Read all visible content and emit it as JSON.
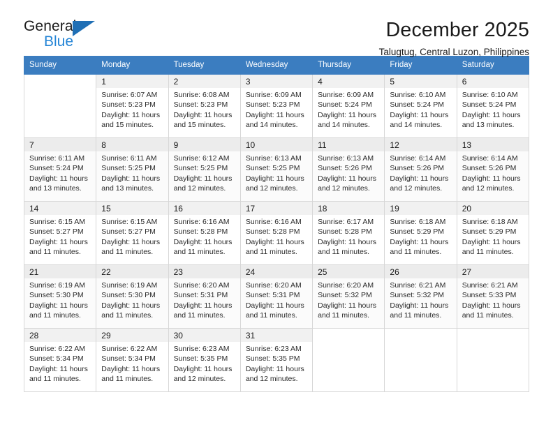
{
  "brand": {
    "name_top": "General",
    "name_bottom": "Blue",
    "triangle_color": "#1f6fb5",
    "blue_text_color": "#2585d6"
  },
  "header": {
    "title": "December 2025",
    "subtitle": "Talugtug, Central Luzon, Philippines"
  },
  "theme": {
    "header_bg": "#3b7dc0",
    "header_text": "#ffffff",
    "grid_border": "#d7d7d7",
    "daynum_bg": "#f1f1f1",
    "row_alt_bg": "#fbfbfb"
  },
  "weekdays": [
    "Sunday",
    "Monday",
    "Tuesday",
    "Wednesday",
    "Thursday",
    "Friday",
    "Saturday"
  ],
  "weeks": [
    [
      {
        "day": "",
        "sunrise": "",
        "sunset": "",
        "daylight_1": "",
        "daylight_2": ""
      },
      {
        "day": "1",
        "sunrise": "Sunrise: 6:07 AM",
        "sunset": "Sunset: 5:23 PM",
        "daylight_1": "Daylight: 11 hours",
        "daylight_2": "and 15 minutes."
      },
      {
        "day": "2",
        "sunrise": "Sunrise: 6:08 AM",
        "sunset": "Sunset: 5:23 PM",
        "daylight_1": "Daylight: 11 hours",
        "daylight_2": "and 15 minutes."
      },
      {
        "day": "3",
        "sunrise": "Sunrise: 6:09 AM",
        "sunset": "Sunset: 5:23 PM",
        "daylight_1": "Daylight: 11 hours",
        "daylight_2": "and 14 minutes."
      },
      {
        "day": "4",
        "sunrise": "Sunrise: 6:09 AM",
        "sunset": "Sunset: 5:24 PM",
        "daylight_1": "Daylight: 11 hours",
        "daylight_2": "and 14 minutes."
      },
      {
        "day": "5",
        "sunrise": "Sunrise: 6:10 AM",
        "sunset": "Sunset: 5:24 PM",
        "daylight_1": "Daylight: 11 hours",
        "daylight_2": "and 14 minutes."
      },
      {
        "day": "6",
        "sunrise": "Sunrise: 6:10 AM",
        "sunset": "Sunset: 5:24 PM",
        "daylight_1": "Daylight: 11 hours",
        "daylight_2": "and 13 minutes."
      }
    ],
    [
      {
        "day": "7",
        "sunrise": "Sunrise: 6:11 AM",
        "sunset": "Sunset: 5:24 PM",
        "daylight_1": "Daylight: 11 hours",
        "daylight_2": "and 13 minutes."
      },
      {
        "day": "8",
        "sunrise": "Sunrise: 6:11 AM",
        "sunset": "Sunset: 5:25 PM",
        "daylight_1": "Daylight: 11 hours",
        "daylight_2": "and 13 minutes."
      },
      {
        "day": "9",
        "sunrise": "Sunrise: 6:12 AM",
        "sunset": "Sunset: 5:25 PM",
        "daylight_1": "Daylight: 11 hours",
        "daylight_2": "and 12 minutes."
      },
      {
        "day": "10",
        "sunrise": "Sunrise: 6:13 AM",
        "sunset": "Sunset: 5:25 PM",
        "daylight_1": "Daylight: 11 hours",
        "daylight_2": "and 12 minutes."
      },
      {
        "day": "11",
        "sunrise": "Sunrise: 6:13 AM",
        "sunset": "Sunset: 5:26 PM",
        "daylight_1": "Daylight: 11 hours",
        "daylight_2": "and 12 minutes."
      },
      {
        "day": "12",
        "sunrise": "Sunrise: 6:14 AM",
        "sunset": "Sunset: 5:26 PM",
        "daylight_1": "Daylight: 11 hours",
        "daylight_2": "and 12 minutes."
      },
      {
        "day": "13",
        "sunrise": "Sunrise: 6:14 AM",
        "sunset": "Sunset: 5:26 PM",
        "daylight_1": "Daylight: 11 hours",
        "daylight_2": "and 12 minutes."
      }
    ],
    [
      {
        "day": "14",
        "sunrise": "Sunrise: 6:15 AM",
        "sunset": "Sunset: 5:27 PM",
        "daylight_1": "Daylight: 11 hours",
        "daylight_2": "and 11 minutes."
      },
      {
        "day": "15",
        "sunrise": "Sunrise: 6:15 AM",
        "sunset": "Sunset: 5:27 PM",
        "daylight_1": "Daylight: 11 hours",
        "daylight_2": "and 11 minutes."
      },
      {
        "day": "16",
        "sunrise": "Sunrise: 6:16 AM",
        "sunset": "Sunset: 5:28 PM",
        "daylight_1": "Daylight: 11 hours",
        "daylight_2": "and 11 minutes."
      },
      {
        "day": "17",
        "sunrise": "Sunrise: 6:16 AM",
        "sunset": "Sunset: 5:28 PM",
        "daylight_1": "Daylight: 11 hours",
        "daylight_2": "and 11 minutes."
      },
      {
        "day": "18",
        "sunrise": "Sunrise: 6:17 AM",
        "sunset": "Sunset: 5:28 PM",
        "daylight_1": "Daylight: 11 hours",
        "daylight_2": "and 11 minutes."
      },
      {
        "day": "19",
        "sunrise": "Sunrise: 6:18 AM",
        "sunset": "Sunset: 5:29 PM",
        "daylight_1": "Daylight: 11 hours",
        "daylight_2": "and 11 minutes."
      },
      {
        "day": "20",
        "sunrise": "Sunrise: 6:18 AM",
        "sunset": "Sunset: 5:29 PM",
        "daylight_1": "Daylight: 11 hours",
        "daylight_2": "and 11 minutes."
      }
    ],
    [
      {
        "day": "21",
        "sunrise": "Sunrise: 6:19 AM",
        "sunset": "Sunset: 5:30 PM",
        "daylight_1": "Daylight: 11 hours",
        "daylight_2": "and 11 minutes."
      },
      {
        "day": "22",
        "sunrise": "Sunrise: 6:19 AM",
        "sunset": "Sunset: 5:30 PM",
        "daylight_1": "Daylight: 11 hours",
        "daylight_2": "and 11 minutes."
      },
      {
        "day": "23",
        "sunrise": "Sunrise: 6:20 AM",
        "sunset": "Sunset: 5:31 PM",
        "daylight_1": "Daylight: 11 hours",
        "daylight_2": "and 11 minutes."
      },
      {
        "day": "24",
        "sunrise": "Sunrise: 6:20 AM",
        "sunset": "Sunset: 5:31 PM",
        "daylight_1": "Daylight: 11 hours",
        "daylight_2": "and 11 minutes."
      },
      {
        "day": "25",
        "sunrise": "Sunrise: 6:20 AM",
        "sunset": "Sunset: 5:32 PM",
        "daylight_1": "Daylight: 11 hours",
        "daylight_2": "and 11 minutes."
      },
      {
        "day": "26",
        "sunrise": "Sunrise: 6:21 AM",
        "sunset": "Sunset: 5:32 PM",
        "daylight_1": "Daylight: 11 hours",
        "daylight_2": "and 11 minutes."
      },
      {
        "day": "27",
        "sunrise": "Sunrise: 6:21 AM",
        "sunset": "Sunset: 5:33 PM",
        "daylight_1": "Daylight: 11 hours",
        "daylight_2": "and 11 minutes."
      }
    ],
    [
      {
        "day": "28",
        "sunrise": "Sunrise: 6:22 AM",
        "sunset": "Sunset: 5:34 PM",
        "daylight_1": "Daylight: 11 hours",
        "daylight_2": "and 11 minutes."
      },
      {
        "day": "29",
        "sunrise": "Sunrise: 6:22 AM",
        "sunset": "Sunset: 5:34 PM",
        "daylight_1": "Daylight: 11 hours",
        "daylight_2": "and 11 minutes."
      },
      {
        "day": "30",
        "sunrise": "Sunrise: 6:23 AM",
        "sunset": "Sunset: 5:35 PM",
        "daylight_1": "Daylight: 11 hours",
        "daylight_2": "and 12 minutes."
      },
      {
        "day": "31",
        "sunrise": "Sunrise: 6:23 AM",
        "sunset": "Sunset: 5:35 PM",
        "daylight_1": "Daylight: 11 hours",
        "daylight_2": "and 12 minutes."
      },
      {
        "day": "",
        "sunrise": "",
        "sunset": "",
        "daylight_1": "",
        "daylight_2": ""
      },
      {
        "day": "",
        "sunrise": "",
        "sunset": "",
        "daylight_1": "",
        "daylight_2": ""
      },
      {
        "day": "",
        "sunrise": "",
        "sunset": "",
        "daylight_1": "",
        "daylight_2": ""
      }
    ]
  ]
}
